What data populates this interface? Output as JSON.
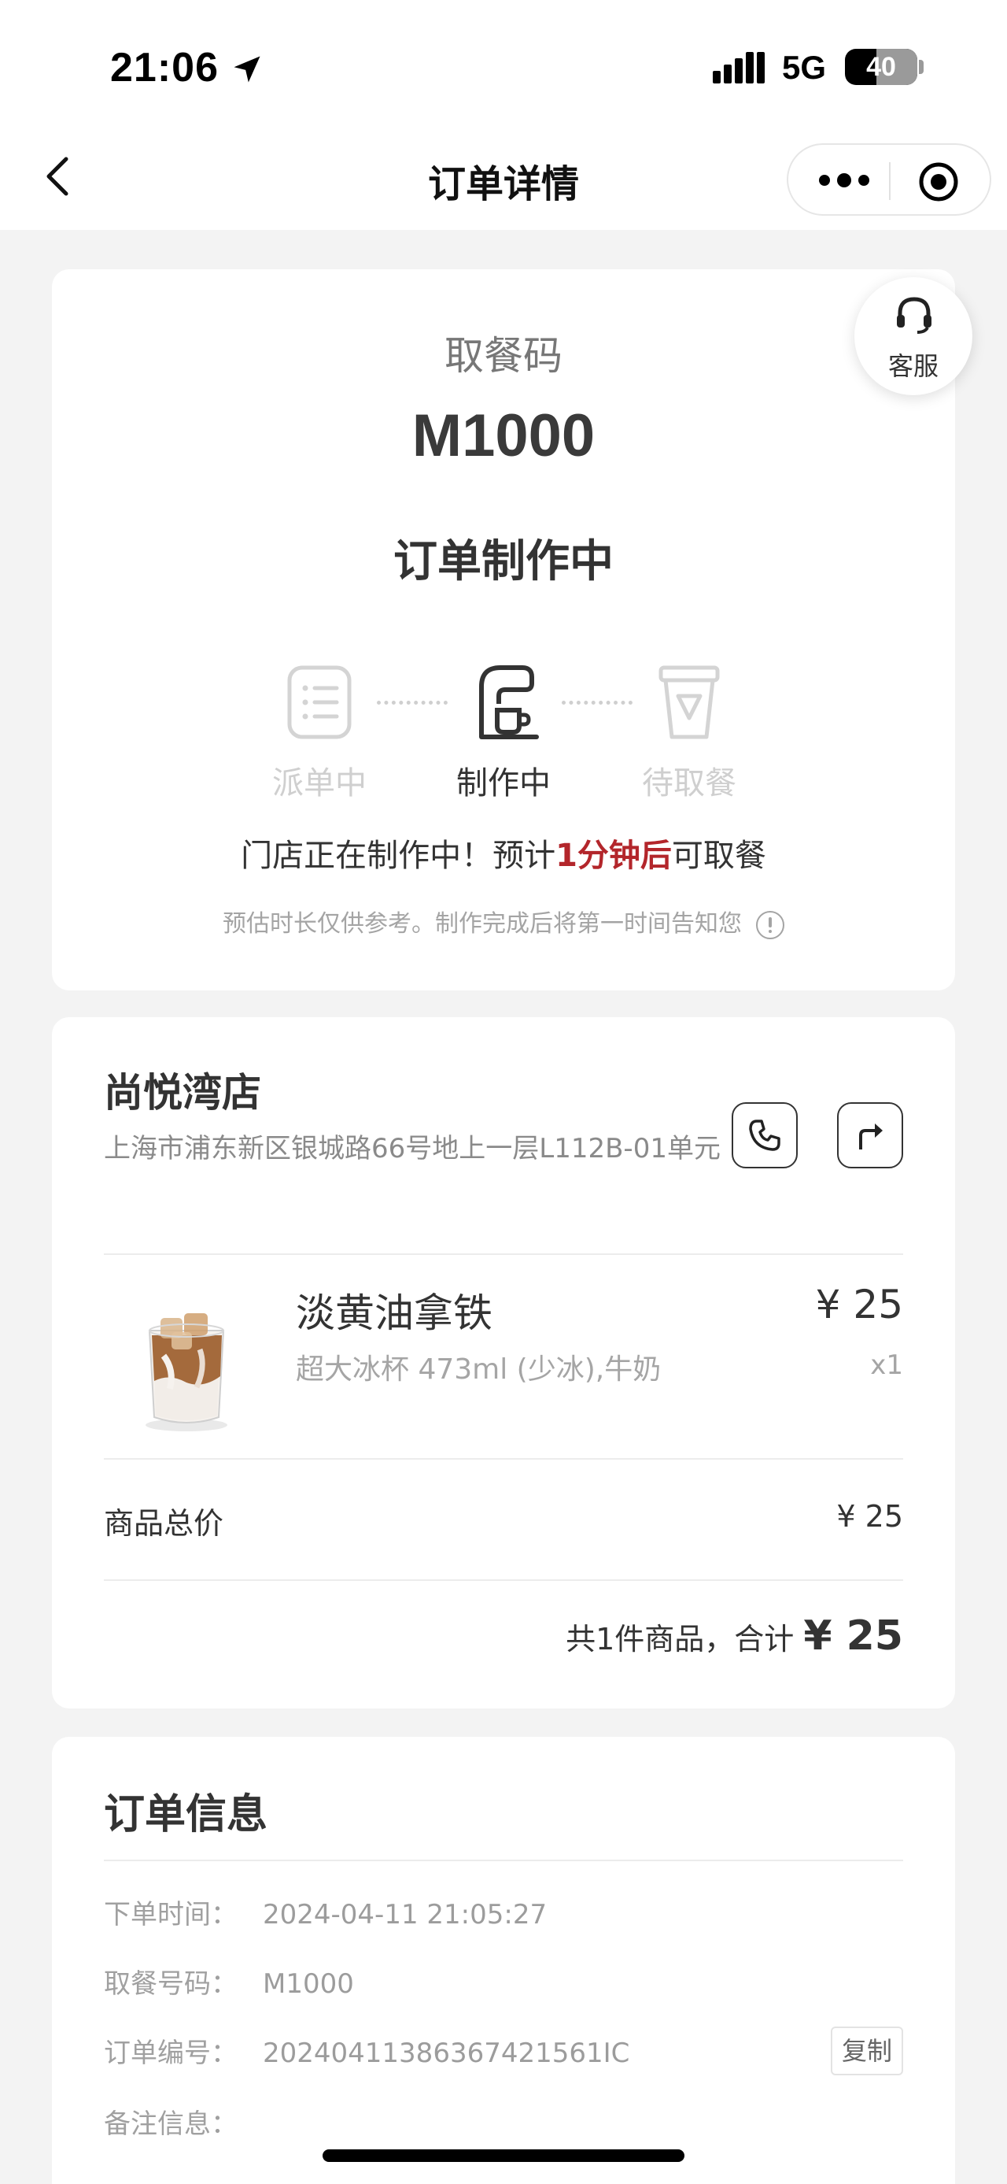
{
  "status_bar": {
    "time": "21:06",
    "network": "5G",
    "battery": "40"
  },
  "nav": {
    "title": "订单详情"
  },
  "pickup": {
    "label": "取餐码",
    "code": "M1000",
    "status": "订单制作中",
    "customer_service_label": "客服",
    "steps": [
      {
        "label": "派单中",
        "icon": "order-list-icon",
        "active": false
      },
      {
        "label": "制作中",
        "icon": "coffee-machine-icon",
        "active": true
      },
      {
        "label": "待取餐",
        "icon": "coffee-cup-icon",
        "active": false
      }
    ],
    "tip_before": "门店正在制作中！预计",
    "tip_highlight": "1分钟后",
    "tip_after": "可取餐",
    "tip_sub": "预估时长仅供参考。制作完成后将第一时间告知您"
  },
  "store": {
    "name": "尚悦湾店",
    "address": "上海市浦东新区银城路66号地上一层L112B-01单元"
  },
  "product": {
    "name": "淡黄油拿铁",
    "spec": "超大冰杯 473ml (少冰),牛奶",
    "price": "¥ 25",
    "qty": "x1"
  },
  "summary": {
    "subtotal_label": "商品总价",
    "subtotal_value": "¥ 25",
    "total_prefix": "共1件商品，合计",
    "total_value": "¥ 25"
  },
  "order_info": {
    "title": "订单信息",
    "rows": [
      {
        "label": "下单时间：",
        "value": "2024-04-11 21:05:27"
      },
      {
        "label": "取餐号码：",
        "value": "M1000"
      },
      {
        "label": "订单编号：",
        "value": "20240411386367421561IC"
      },
      {
        "label": "备注信息：",
        "value": ""
      }
    ],
    "copy_label": "复制"
  },
  "colors": {
    "accent": "#b3262b",
    "background": "#f3f3f3",
    "muted": "#cfcfcf"
  }
}
